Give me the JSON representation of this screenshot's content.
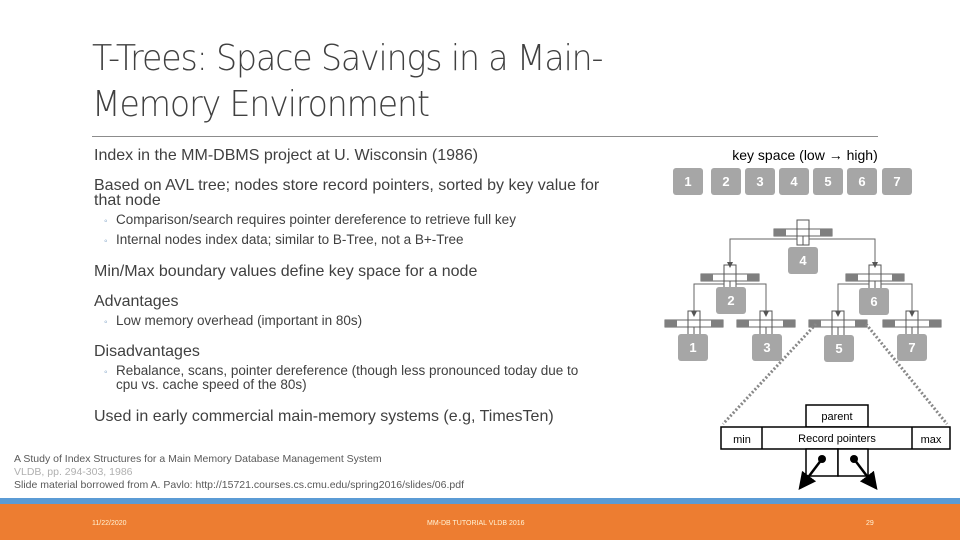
{
  "slide": {
    "title": "T-Trees: Space Savings in a Main-Memory Environment",
    "title_lines": [
      "T-Trees: Space Savings in a Main-",
      "Memory Environment"
    ],
    "bullets": [
      {
        "text": "Index in the MM-DBMS project at U. Wisconsin (1986)"
      },
      {
        "text_lines": [
          "Based on AVL tree; nodes store record pointers, sorted by key value for",
          "that node"
        ],
        "sub": [
          "Comparison/search requires pointer dereference to retrieve full key",
          "Internal nodes index data; similar to B-Tree, not a B+-Tree"
        ]
      },
      {
        "text": "Min/Max boundary values define key space for a node"
      },
      {
        "text": "Advantages",
        "sub": [
          "Low memory overhead (important in 80s)"
        ]
      },
      {
        "text": "Disadvantages",
        "sub_lines": [
          "Rebalance, scans, pointer dereference (though less pronounced today due to",
          "cpu vs. cache speed of the 80s)"
        ]
      },
      {
        "text": "Used in early commercial main-memory systems (e.g, TimesTen)"
      }
    ],
    "references": [
      "A Study of Index Structures for a Main Memory Database Management System",
      "VLDB, pp. 294-303, 1986",
      "Slide material borrowed from  A. Pavlo: http://15721.courses.cs.cmu.edu/spring2016/slides/06.pdf"
    ]
  },
  "diagram": {
    "key_space_label": "key space (low → high)",
    "keys": [
      "1",
      "2",
      "3",
      "4",
      "5",
      "6",
      "7"
    ],
    "tree": {
      "root": "4",
      "level2": [
        "2",
        "6"
      ],
      "leaves": [
        "1",
        "3",
        "5",
        "7"
      ]
    },
    "node_detail": {
      "parent_label": "parent",
      "min_label": "min",
      "record_pointers_label": "Record pointers",
      "max_label": "max"
    },
    "colors": {
      "key_box": "#a6a6a6",
      "node_dark": "#7f7f7f",
      "line": "#666666"
    }
  },
  "footer": {
    "date": "11/22/2020",
    "center": "MM-DB TUTORIAL VLDB 2016",
    "page": "29",
    "bar_color": "#ed7d31",
    "accent_color": "#5b9bd5"
  }
}
